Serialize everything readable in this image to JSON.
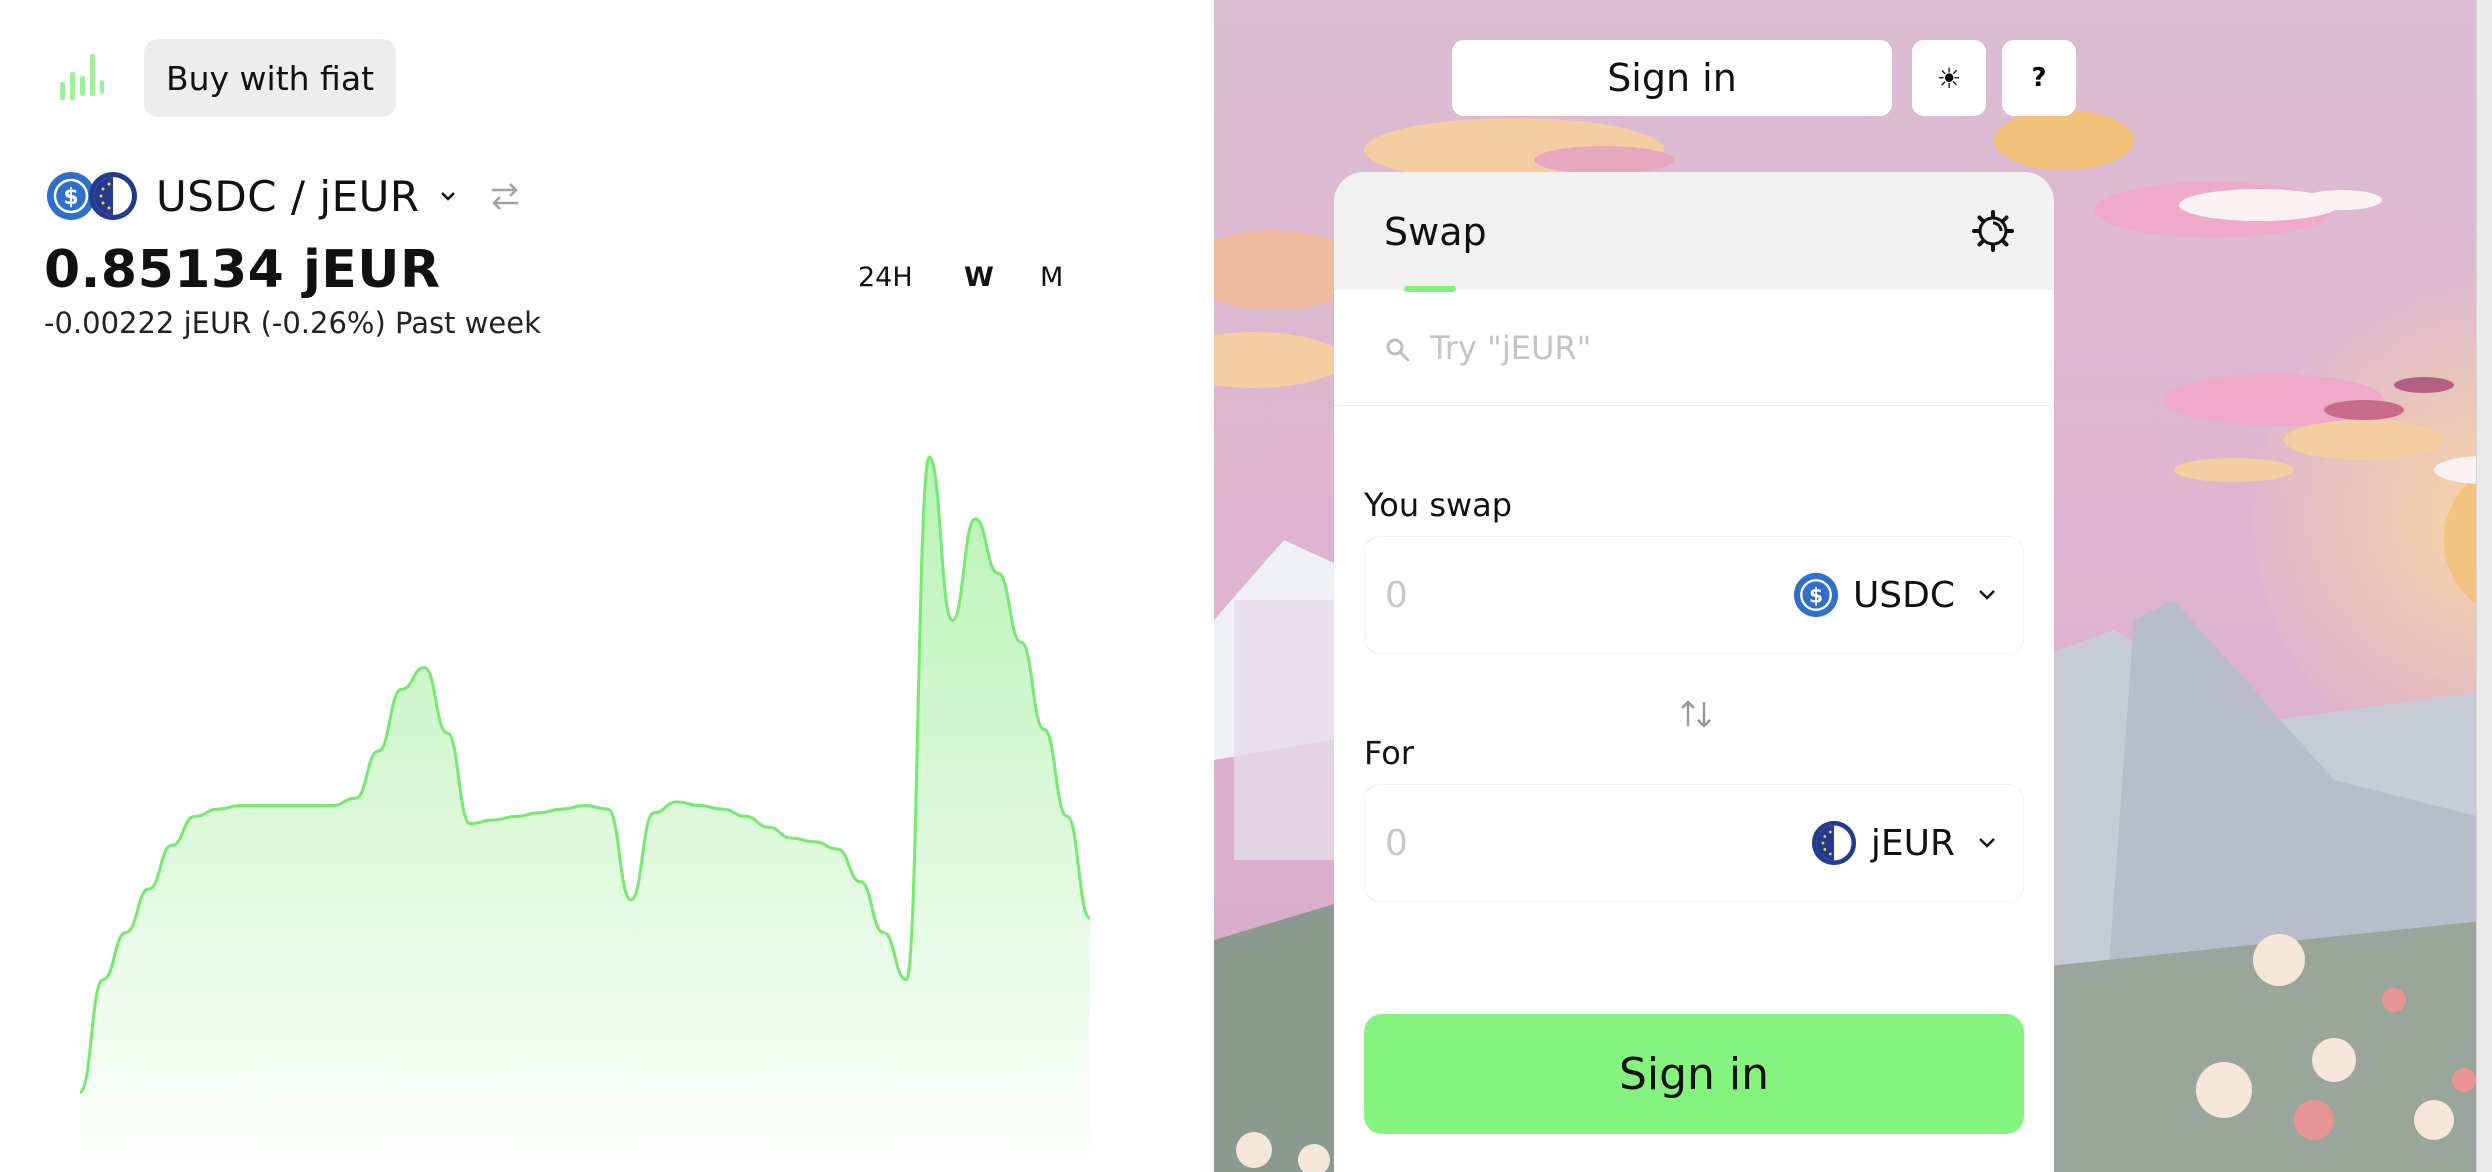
{
  "header": {
    "buy_fiat_label": "Buy with fiat",
    "logo_icon": "bar-chart-logo-icon"
  },
  "market": {
    "pair_label": "USDC / jEUR",
    "base_token": "USDC",
    "quote_token": "jEUR",
    "price": "0.85134 jEUR",
    "change": "-0.00222 jEUR (-0.26%) Past week",
    "periods": [
      "24H",
      "W",
      "M"
    ],
    "selected_period": "W"
  },
  "chart_data": {
    "type": "area",
    "title": "",
    "xlabel": "",
    "ylabel": "",
    "series": [
      {
        "values": [
          0.8402,
          0.8433,
          0.8446,
          0.8458,
          0.847,
          0.8478,
          0.848,
          0.8481,
          0.8481,
          0.8481,
          0.8481,
          0.8481,
          0.8483,
          0.8496,
          0.8513,
          0.8519,
          0.8501,
          0.8476,
          0.8477,
          0.8478,
          0.8479,
          0.848,
          0.8481,
          0.848,
          0.8455,
          0.8479,
          0.8482,
          0.8481,
          0.848,
          0.8478,
          0.8475,
          0.8472,
          0.8471,
          0.8469,
          0.846,
          0.8446,
          0.8433,
          0.8577,
          0.8532,
          0.856,
          0.8545,
          0.8526,
          0.8502,
          0.8478,
          0.845
        ]
      }
    ],
    "line_color": "#76e96f",
    "fill_color": "#c8f7c5",
    "ylim": [
      0.838,
      0.859
    ],
    "grid": false
  },
  "swap": {
    "tab_label": "Swap",
    "search_placeholder": "Try \"jEUR\"",
    "you_swap_label": "You swap",
    "for_label": "For",
    "from_amount_placeholder": "0",
    "to_amount_placeholder": "0",
    "from_token": "USDC",
    "to_token": "jEUR",
    "submit_label": "Sign in"
  },
  "topbar": {
    "sign_in_label": "Sign in",
    "theme_icon": "☀",
    "help_label": "?"
  },
  "colors": {
    "accent": "#84f47e",
    "chart_line": "#76e96f",
    "usdc_blue": "#2f6fc9",
    "jeur_blue": "#233a8f",
    "sky": "#dcb6cf"
  }
}
